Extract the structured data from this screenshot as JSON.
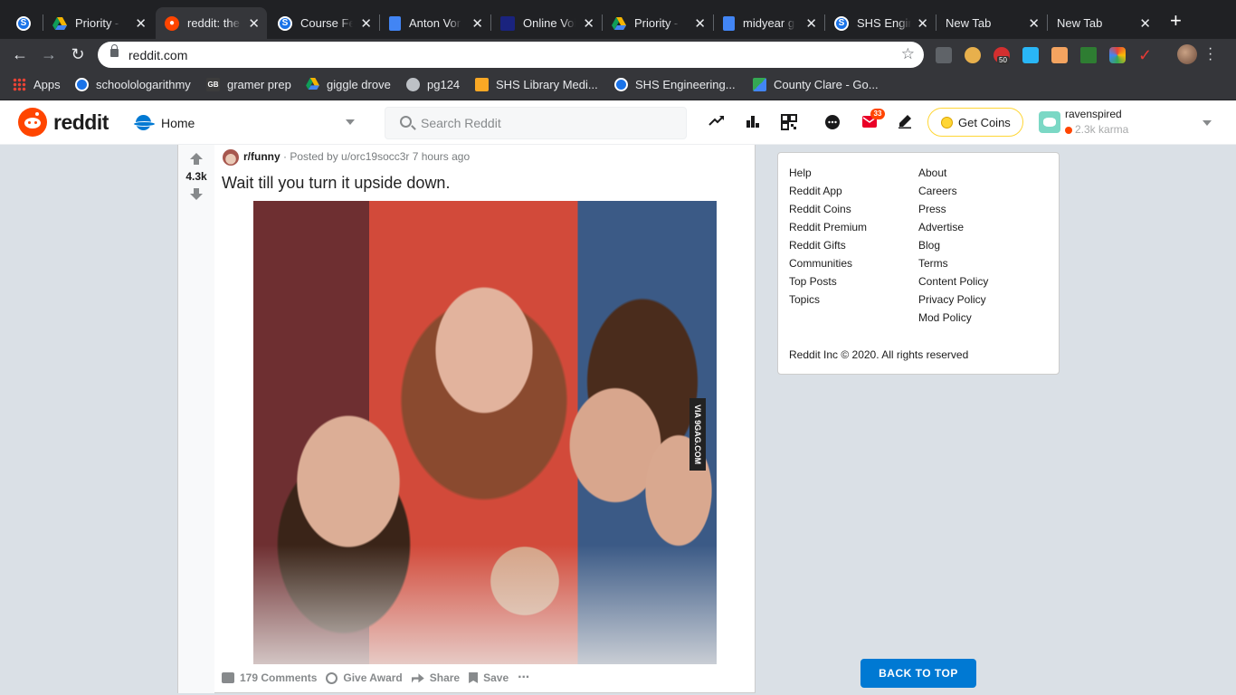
{
  "browser": {
    "tabs": [
      {
        "title": "",
        "icon": "sfav-icon",
        "active": false
      },
      {
        "title": "Priority - Google Drive",
        "icon": "drive-icon",
        "active": false
      },
      {
        "title": "reddit: the front page",
        "icon": "reddit-icon",
        "active": true
      },
      {
        "title": "Course Feed",
        "icon": "sfav-icon",
        "active": false
      },
      {
        "title": "Anton Vorn",
        "icon": "docs-icon",
        "active": false
      },
      {
        "title": "Online Voice",
        "icon": "voice-icon",
        "active": false
      },
      {
        "title": "Priority - Google Drive",
        "icon": "drive-icon",
        "active": false
      },
      {
        "title": "midyear goals",
        "icon": "docs-icon",
        "active": false
      },
      {
        "title": "SHS Engineering",
        "icon": "sfav-icon",
        "active": false
      },
      {
        "title": "New Tab",
        "icon": "",
        "active": false
      },
      {
        "title": "New Tab",
        "icon": "",
        "active": false
      }
    ],
    "url": "reddit.com",
    "extension_badge": "50",
    "bookmarks": [
      {
        "label": "Apps"
      },
      {
        "label": "schoolologarithmy"
      },
      {
        "label": "gramer prep"
      },
      {
        "label": "giggle drove"
      },
      {
        "label": "pg124"
      },
      {
        "label": "SHS Library Medi..."
      },
      {
        "label": "SHS Engineering..."
      },
      {
        "label": "County Clare - Go..."
      }
    ]
  },
  "header": {
    "logo_text": "reddit",
    "feed_label": "Home",
    "search_placeholder": "Search Reddit",
    "mail_count": "33",
    "get_coins_label": "Get Coins",
    "username": "ravenspired",
    "karma": "2.3k karma"
  },
  "post": {
    "score": "4.3k",
    "subreddit": "r/funny",
    "posted_by": "· Posted by u/orc19socc3r 7 hours ago",
    "title": "Wait till you turn it upside down.",
    "watermark": "VIA 9GAG.COM",
    "actions": {
      "comments": "179 Comments",
      "award": "Give Award",
      "share": "Share",
      "save": "Save",
      "more": "···"
    }
  },
  "sidebar": {
    "col1": [
      "Help",
      "Reddit App",
      "Reddit Coins",
      "Reddit Premium",
      "Reddit Gifts",
      "Communities",
      "Top Posts",
      "Topics"
    ],
    "col2": [
      "About",
      "Careers",
      "Press",
      "Advertise",
      "Blog",
      "Terms",
      "Content Policy",
      "Privacy Policy",
      "Mod Policy"
    ],
    "copyright": "Reddit Inc © 2020. All rights reserved"
  },
  "back_to_top": "BACK TO TOP",
  "colors": {
    "reddit_orange": "#ff4500",
    "reddit_blue": "#0079d3",
    "page_bg": "#dae0e6"
  }
}
